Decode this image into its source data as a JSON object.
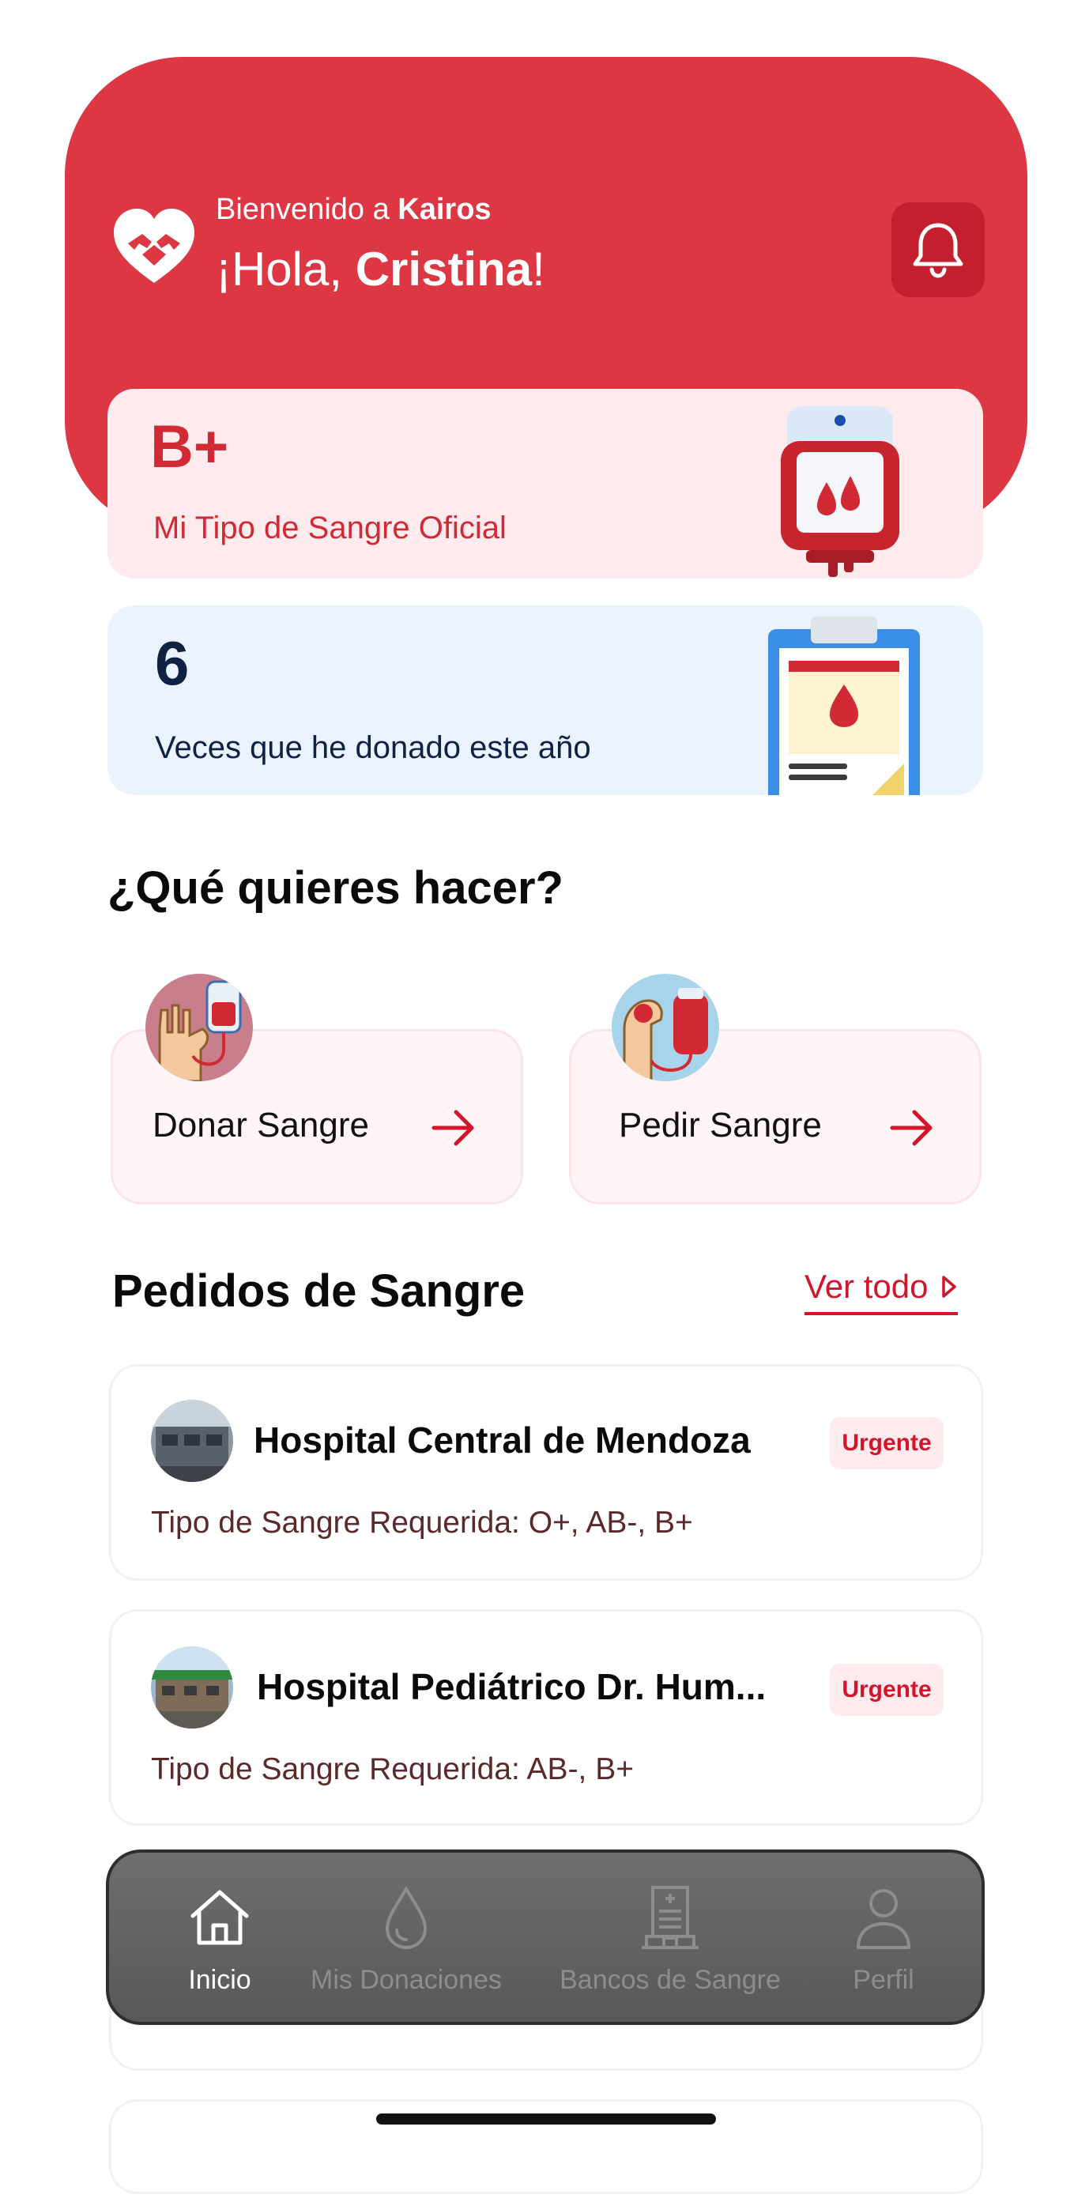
{
  "header": {
    "welcome_prefix": "Bienvenido a ",
    "app_name": "Kairos",
    "greeting_prefix": "¡Hola, ",
    "user_name": "Cristina",
    "greeting_suffix": "!",
    "bell_icon": "bell-icon",
    "logo_icon": "heart-hands-logo"
  },
  "blood_card": {
    "blood_type": "B+",
    "label": "Mi Tipo de Sangre Oficial"
  },
  "donation_card": {
    "count": "6",
    "label": "Veces que he donado este año"
  },
  "actions": {
    "title": "¿Qué quieres hacer?",
    "items": [
      {
        "label": "Donar Sangre",
        "icon": "donate-blood-icon"
      },
      {
        "label": "Pedir Sangre",
        "icon": "request-blood-icon"
      }
    ]
  },
  "requests": {
    "title": "Pedidos de Sangre",
    "see_all": "Ver todo",
    "items": [
      {
        "hospital": "Hospital Central de Mendoza",
        "badge": "Urgente",
        "types": "Tipo de Sangre Requerida: O+, AB-, B+"
      },
      {
        "hospital": "Hospital Pediátrico Dr. Hum...",
        "badge": "Urgente",
        "types": "Tipo de Sangre Requerida: AB-, B+"
      }
    ]
  },
  "tabbar": {
    "items": [
      {
        "label": "Inicio",
        "icon": "home-icon",
        "active": true
      },
      {
        "label": "Mis Donaciones",
        "icon": "drop-icon",
        "active": false
      },
      {
        "label": "Bancos de Sangre",
        "icon": "hospital-icon",
        "active": false
      },
      {
        "label": "Perfil",
        "icon": "user-icon",
        "active": false
      }
    ]
  },
  "colors": {
    "primary": "#dc3743",
    "accent_red": "#d2152b",
    "blood_card_bg": "#fdebed",
    "count_card_bg": "#ebf3ff",
    "navy": "#0f2244"
  }
}
